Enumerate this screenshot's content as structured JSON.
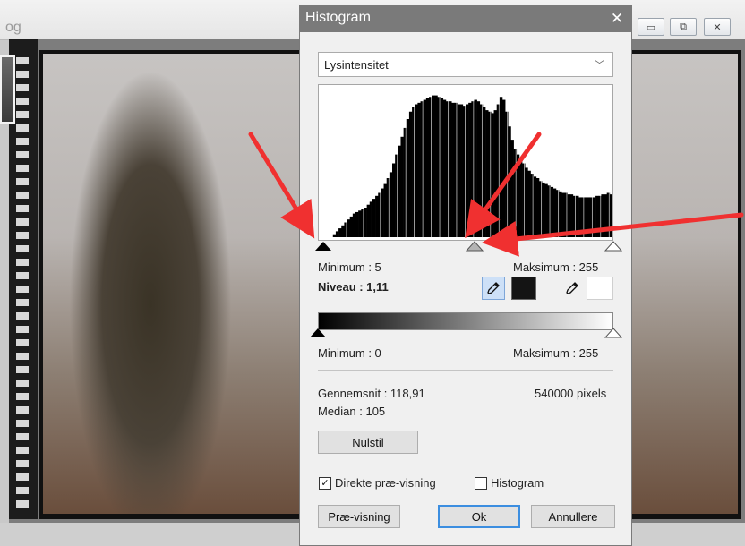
{
  "background_window": {
    "title_fragment": "og",
    "buttons": [
      {
        "icon": "minimize-icon",
        "glyph": "▭"
      },
      {
        "icon": "restore-icon",
        "glyph": "⧉"
      },
      {
        "icon": "close-icon",
        "glyph": "✕"
      }
    ]
  },
  "dialog": {
    "title": "Histogram",
    "close_glyph": "✕",
    "channel": {
      "selected": "Lysintensitet",
      "chevron": "﹀"
    },
    "input_levels": {
      "min_label": "Minimum : 5",
      "max_label": "Maksimum : 255",
      "level_label": "Niveau : 1,11",
      "min_value": 5,
      "mid_value": 0.52,
      "max_value": 255
    },
    "output_levels": {
      "min_label": "Minimum : 0",
      "max_label": "Maksimum : 255",
      "min_value": 0,
      "max_value": 255
    },
    "stats": {
      "mean": "Gennemsnit : 118,91",
      "median": "Median : 105",
      "pixels": "540000 pixels"
    },
    "reset_label": "Nulstil",
    "direct_preview": {
      "label": "Direkte præ-visning",
      "checked": true
    },
    "histogram_check": {
      "label": "Histogram",
      "checked": false
    },
    "preview_label": "Præ-visning",
    "ok_label": "Ok",
    "cancel_label": "Annullere",
    "check_glyph": "✓"
  },
  "chart_data": {
    "type": "bar",
    "x_range": [
      0,
      255
    ],
    "values": [
      0,
      0,
      0,
      0,
      0,
      0.02,
      0.04,
      0.06,
      0.08,
      0.1,
      0.12,
      0.14,
      0.16,
      0.17,
      0.18,
      0.19,
      0.2,
      0.22,
      0.24,
      0.26,
      0.28,
      0.3,
      0.33,
      0.36,
      0.4,
      0.44,
      0.5,
      0.56,
      0.62,
      0.68,
      0.74,
      0.8,
      0.85,
      0.88,
      0.9,
      0.91,
      0.92,
      0.93,
      0.94,
      0.95,
      0.96,
      0.96,
      0.95,
      0.94,
      0.93,
      0.92,
      0.92,
      0.91,
      0.91,
      0.9,
      0.9,
      0.89,
      0.9,
      0.91,
      0.92,
      0.93,
      0.92,
      0.9,
      0.88,
      0.86,
      0.85,
      0.84,
      0.86,
      0.9,
      0.95,
      0.93,
      0.85,
      0.75,
      0.66,
      0.6,
      0.56,
      0.53,
      0.5,
      0.47,
      0.45,
      0.43,
      0.41,
      0.4,
      0.38,
      0.37,
      0.36,
      0.35,
      0.34,
      0.33,
      0.32,
      0.31,
      0.3,
      0.3,
      0.29,
      0.29,
      0.28,
      0.28,
      0.27,
      0.27,
      0.27,
      0.27,
      0.27,
      0.27,
      0.28,
      0.28,
      0.29,
      0.29,
      0.3,
      0.29
    ],
    "grid": false
  }
}
